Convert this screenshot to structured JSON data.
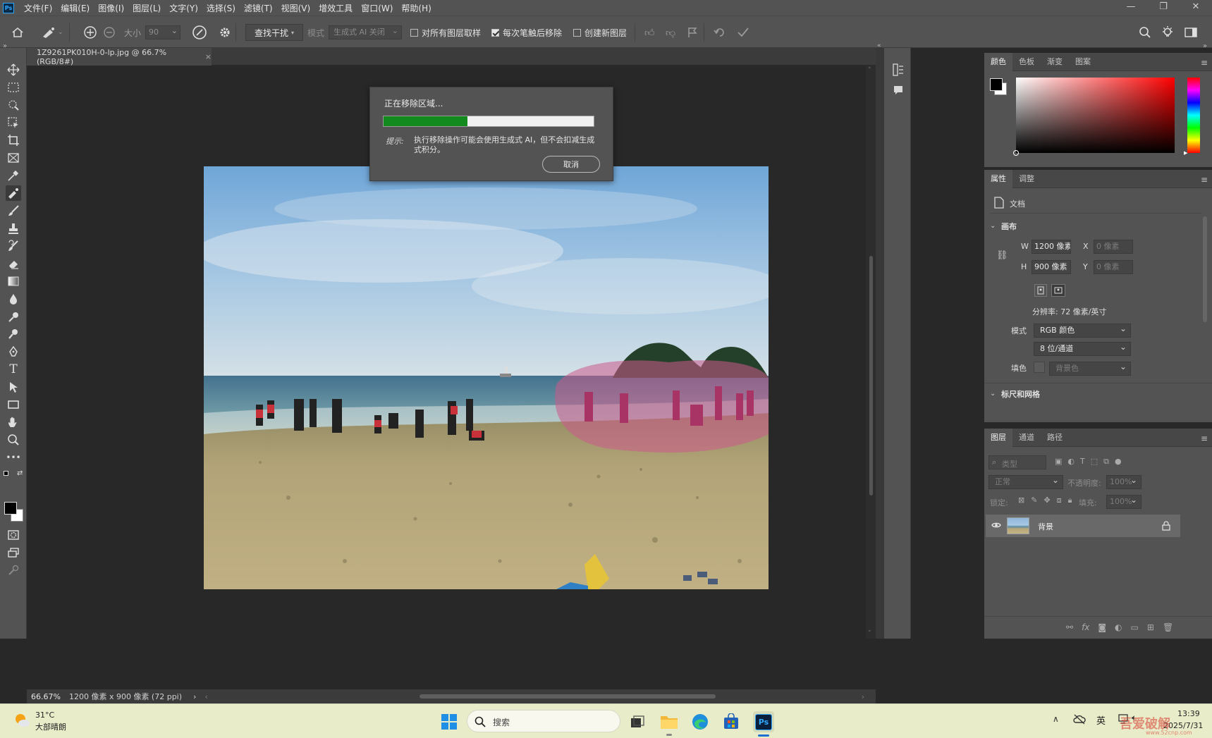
{
  "app": {
    "logo": "Ps"
  },
  "menu": [
    "文件(F)",
    "编辑(E)",
    "图像(I)",
    "图层(L)",
    "文字(Y)",
    "选择(S)",
    "滤镜(T)",
    "视图(V)",
    "增效工具",
    "窗口(W)",
    "帮助(H)"
  ],
  "window_controls": {
    "minimize": "—",
    "maximize": "❐",
    "close": "✕"
  },
  "options": {
    "size_label": "大小",
    "size_value": "90",
    "find_button": "查找干扰",
    "mode_label": "模式",
    "mode_value": "生成式 AI 关闭",
    "sample_all": "对所有图层取样",
    "sample_all_checked": false,
    "remove_after": "每次笔触后移除",
    "remove_after_checked": true,
    "new_layer": "创建新图层",
    "new_layer_checked": false
  },
  "document": {
    "tab_title": "1Z9261PK010H-0-lp.jpg @ 66.7%(RGB/8#)",
    "close": "×"
  },
  "status": {
    "zoom": "66.67%",
    "info": "1200 像素 x 900 像素 (72 ppi)",
    "arrow": "›",
    "scroll_left": "‹",
    "scroll_right": "›"
  },
  "dialog": {
    "title": "正在移除区域...",
    "progress": 0.4,
    "tip_label": "提示:",
    "tip_text": "执行移除操作可能会使用生成式 AI，但不会扣减生成式积分。",
    "cancel": "取消"
  },
  "color_panel": {
    "tabs": [
      "颜色",
      "色板",
      "渐变",
      "图案"
    ],
    "active": 0,
    "fg": "#000000",
    "bg": "#ffffff"
  },
  "properties": {
    "tabs": [
      "属性",
      "调整"
    ],
    "section_doc": "文档",
    "canvas_title": "画布",
    "w_label": "W",
    "w_value": "1200 像素",
    "h_label": "H",
    "h_value": "900 像素",
    "x_label": "X",
    "x_value": "0 像素",
    "y_label": "Y",
    "y_value": "0 像素",
    "resolution": "分辨率: 72 像素/英寸",
    "mode_label": "模式",
    "mode_value": "RGB 颜色",
    "depth_value": "8 位/通道",
    "fill_label": "填色",
    "fill_value": "背景色",
    "rulers_title": "标尺和网格"
  },
  "layers": {
    "tabs": [
      "图层",
      "通道",
      "路径"
    ],
    "filter_placeholder": "类型",
    "blend_mode": "正常",
    "opacity_label": "不透明度:",
    "opacity_value": "100%",
    "lock_label": "锁定:",
    "fill_label": "填充:",
    "fill_value": "100%",
    "items": [
      {
        "name": "背景",
        "visible": true,
        "locked": true
      }
    ]
  },
  "taskbar": {
    "weather_temp": "31°C",
    "weather_desc": "大部晴朗",
    "search_placeholder": "搜索",
    "ime": "英",
    "time": "13:39",
    "date": "2025/7/31",
    "watermark": "吾爱破解",
    "watermark_url": "www.52cnp.com"
  }
}
